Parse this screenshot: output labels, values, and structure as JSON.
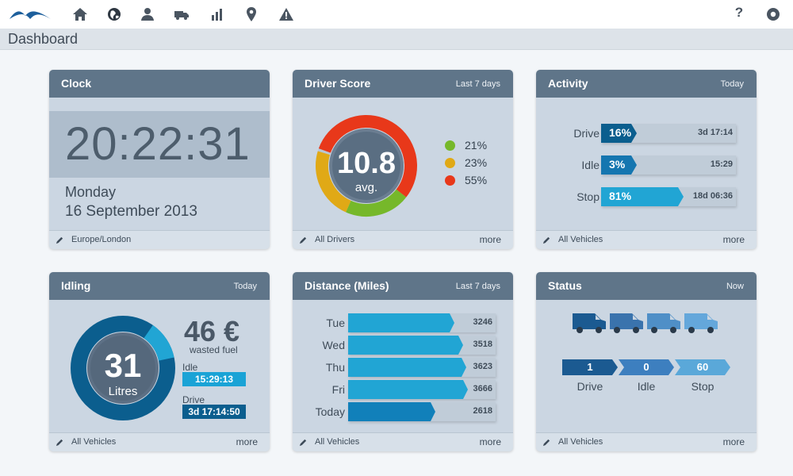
{
  "nav": {
    "icons": [
      "home-icon",
      "globe-icon",
      "user-icon",
      "truck-icon",
      "bar-chart-icon",
      "location-pin-icon",
      "warning-icon"
    ],
    "help_label": "?"
  },
  "page": {
    "title": "Dashboard"
  },
  "colors": {
    "header": "#5f7589",
    "green": "#76b82a",
    "yellow": "#e0a916",
    "red": "#e8381a",
    "blue_dark": "#0b5e8e",
    "blue_mid": "#1d8cc4",
    "blue_light": "#21a5d4"
  },
  "clock": {
    "title": "Clock",
    "time": "20:22:31",
    "day": "Monday",
    "date": "16 September 2013",
    "footer": "Europe/London"
  },
  "driver_score": {
    "title": "Driver Score",
    "period": "Last 7 days",
    "value": "10.8",
    "value_label": "avg.",
    "legend": [
      {
        "value": "21%",
        "fraction": 0.21,
        "color": "#76b82a"
      },
      {
        "value": "23%",
        "fraction": 0.23,
        "color": "#e0a916"
      },
      {
        "value": "55%",
        "fraction": 0.55,
        "color": "#e8381a"
      }
    ],
    "footer": "All Drivers",
    "more": "more"
  },
  "activity": {
    "title": "Activity",
    "period": "Today",
    "rows": [
      {
        "label": "Drive",
        "pct": "16%",
        "fraction": 0.16,
        "duration": "3d 17:14",
        "color": "#0b5e8e"
      },
      {
        "label": "Idle",
        "pct": "3%",
        "fraction": 0.03,
        "duration": "15:29",
        "color": "#1576b0"
      },
      {
        "label": "Stop",
        "pct": "81%",
        "fraction": 0.81,
        "duration": "18d 06:36",
        "color": "#21a5d4"
      }
    ],
    "footer": "All Vehicles",
    "more": "more"
  },
  "idling": {
    "title": "Idling",
    "period": "Today",
    "value": "31",
    "unit": "Litres",
    "cost": "46 €",
    "cost_label": "wasted fuel",
    "idle_label": "Idle",
    "idle_time": "15:29:13",
    "drive_label": "Drive",
    "drive_time": "3d 17:14:50",
    "idle_fraction": 0.12,
    "footer": "All Vehicles",
    "more": "more"
  },
  "distance": {
    "title": "Distance (Miles)",
    "period": "Last 7 days",
    "rows": [
      {
        "label": "Tue",
        "value": "3246"
      },
      {
        "label": "Wed",
        "value": "3518"
      },
      {
        "label": "Thu",
        "value": "3623"
      },
      {
        "label": "Fri",
        "value": "3666"
      },
      {
        "label": "Today",
        "value": "2618"
      }
    ],
    "footer": "All Vehicles",
    "more": "more"
  },
  "status": {
    "title": "Status",
    "period": "Now",
    "items": [
      {
        "count": "1",
        "label": "Drive",
        "color": "#1b5a91"
      },
      {
        "count": "0",
        "label": "Idle",
        "color": "#3d7fbf"
      },
      {
        "count": "60",
        "label": "Stop",
        "color": "#5aa8d9"
      }
    ],
    "vans": [
      "van-icon",
      "van-icon",
      "van-icon",
      "van-icon"
    ],
    "footer": "All Vehicles",
    "more": "more"
  }
}
